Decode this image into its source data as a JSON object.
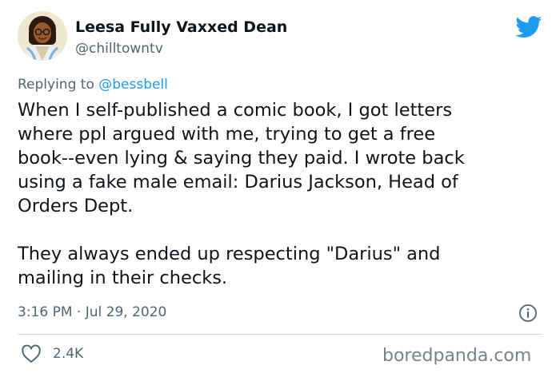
{
  "tweet": {
    "author": {
      "display_name": "Leesa Fully Vaxxed Dean",
      "handle": "@chilltowntv",
      "avatar_icon": "avatar-illustration"
    },
    "reply": {
      "prefix": "Replying to ",
      "mention": "@bessbell"
    },
    "body": {
      "paragraph_1": "When I self-published a comic book, I got letters\nwhere ppl argued with me, trying to get a free\nbook--even lying & saying they paid. I wrote back\nusing a fake male email: Darius Jackson, Head of\nOrders Dept.",
      "paragraph_2": "They always ended up respecting \"Darius\" and\nmailing in their checks."
    },
    "timestamp": "3:16 PM · Jul 29, 2020",
    "likes": "2.4K",
    "icons": {
      "brand": "twitter-bird-icon",
      "info": "info-icon",
      "like": "heart-icon"
    }
  },
  "watermark": "boredpanda.com",
  "colors": {
    "twitter_blue": "#1d9bf0",
    "text": "#0f1419",
    "secondary": "#536471",
    "divider": "#cfd9de"
  }
}
